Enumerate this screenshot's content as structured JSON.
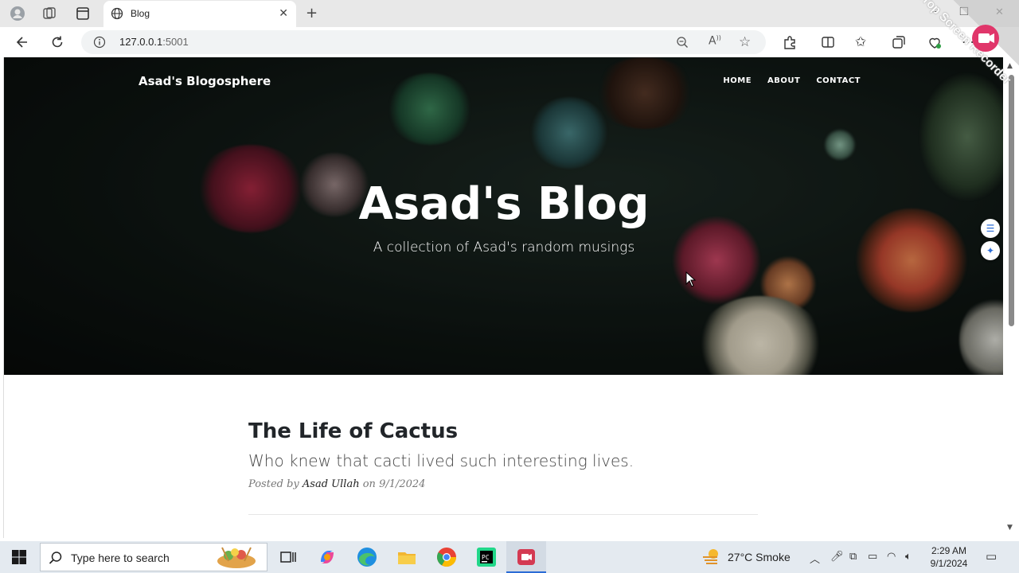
{
  "browser": {
    "tab_title": "Blog",
    "url_host": "127.0.0.1",
    "url_port": ":5001"
  },
  "site": {
    "brand": "Asad's Blogosphere",
    "nav": [
      "HOME",
      "ABOUT",
      "CONTACT"
    ],
    "hero_title": "Asad's Blog",
    "hero_subtitle": "A collection of Asad's random musings"
  },
  "post": {
    "title": "The Life of Cactus",
    "subtitle": "Who knew that cacti lived such interesting lives.",
    "meta_prefix": "Posted by",
    "author": "Asad Ullah",
    "meta_on": "on",
    "date": "9/1/2024"
  },
  "watermark": "iTop Screen Recorder",
  "taskbar": {
    "search_placeholder": "Type here to search",
    "weather": "27°C  Smoke",
    "time": "2:29 AM",
    "date": "9/1/2024"
  },
  "icons": {
    "back": "arrow-left-icon",
    "refresh": "refresh-icon",
    "info": "info-icon",
    "zoom": "zoom-icon",
    "read_aloud": "read-aloud-icon",
    "favorite": "star-icon",
    "extensions": "puzzle-icon",
    "split": "split-screen-icon",
    "favorites": "favorites-icon",
    "collections": "collections-icon",
    "more": "more-icon"
  }
}
